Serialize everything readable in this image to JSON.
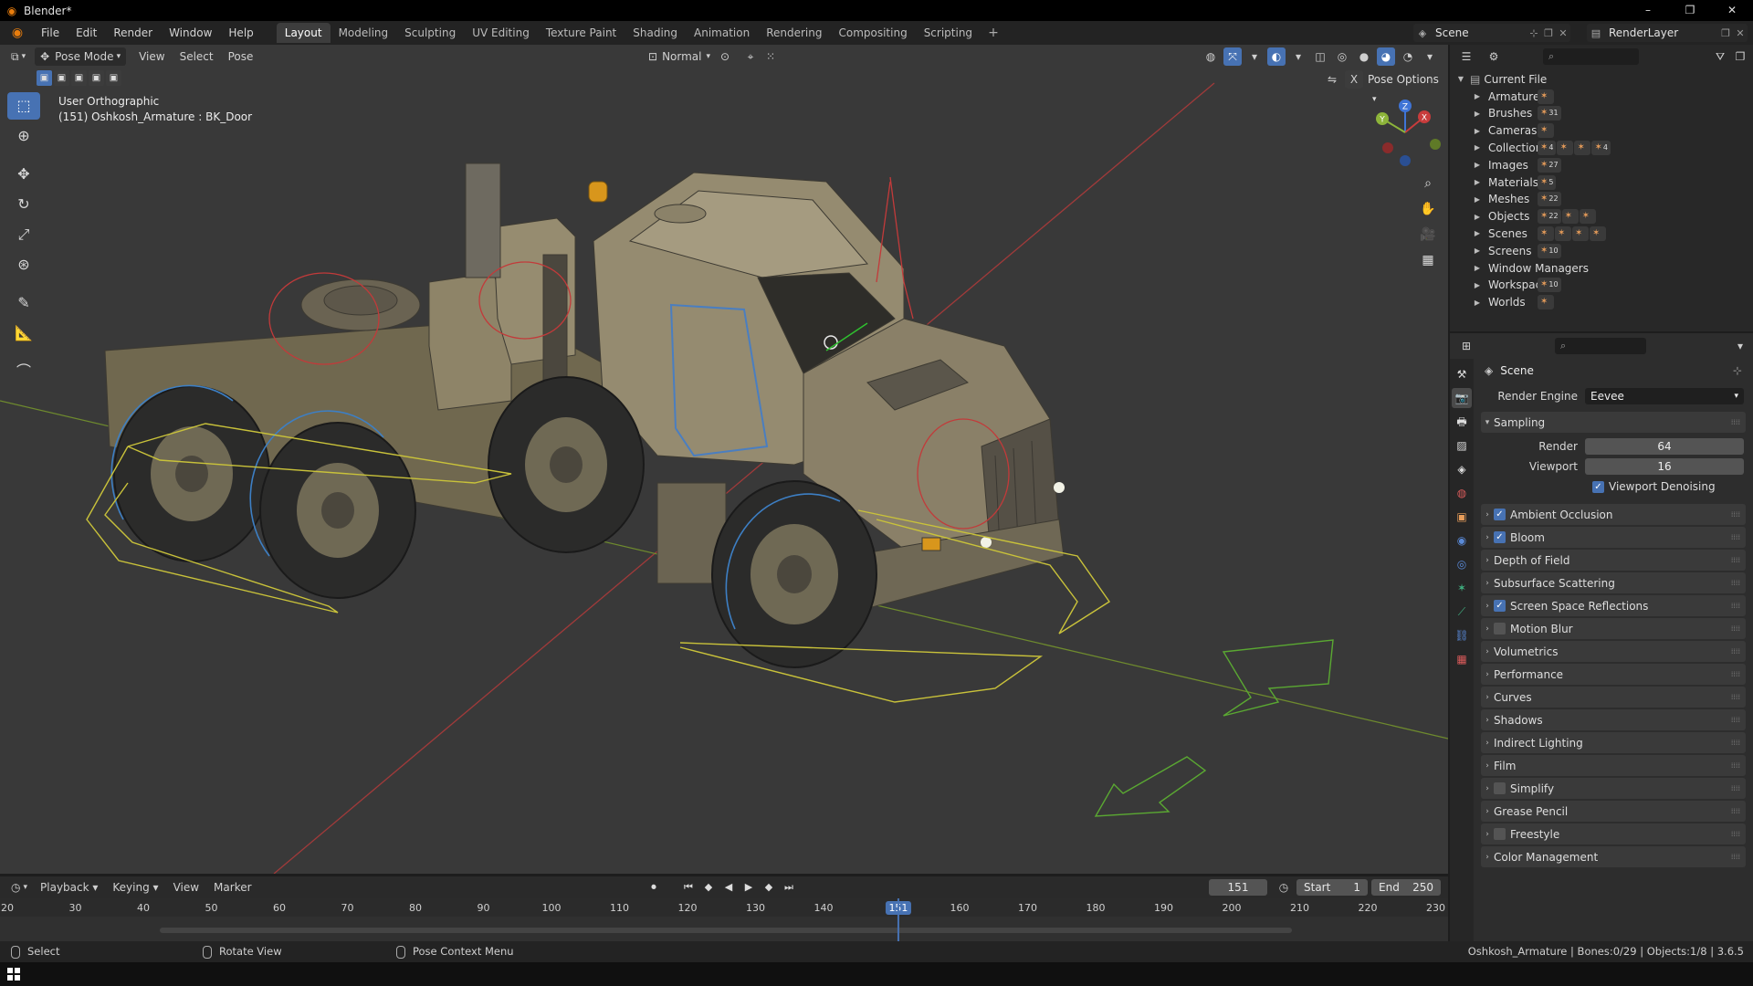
{
  "window": {
    "title": "Blender*",
    "minimize": "–",
    "maximize": "❐",
    "close": "✕"
  },
  "menu": [
    "File",
    "Edit",
    "Render",
    "Window",
    "Help"
  ],
  "workspaces": [
    "Layout",
    "Modeling",
    "Sculpting",
    "UV Editing",
    "Texture Paint",
    "Shading",
    "Animation",
    "Rendering",
    "Compositing",
    "Scripting"
  ],
  "workspace_add": "+",
  "scene_name": "Scene",
  "render_layer": "RenderLayer",
  "viewport": {
    "mode": "Pose Mode",
    "menus": [
      "View",
      "Select",
      "Pose"
    ],
    "orientation": "Normal",
    "pose_options": "Pose Options",
    "view_name": "User Orthographic",
    "object_info": "(151) Oshkosh_Armature : BK_Door",
    "gizmo": {
      "x": "X",
      "y": "Y",
      "z": "Z"
    }
  },
  "timeline": {
    "menus": [
      "Playback",
      "Keying",
      "View",
      "Marker"
    ],
    "current_frame": "151",
    "start_label": "Start",
    "start": "1",
    "end_label": "End",
    "end": "250",
    "ticks": [
      "20",
      "30",
      "40",
      "50",
      "60",
      "70",
      "80",
      "90",
      "100",
      "110",
      "120",
      "130",
      "140",
      "151",
      "160",
      "170",
      "180",
      "190",
      "200",
      "210",
      "220",
      "230"
    ]
  },
  "outliner": {
    "root": "Current File",
    "items": [
      {
        "label": "Armatures",
        "badges": [
          ""
        ]
      },
      {
        "label": "Brushes",
        "badges": [
          "31"
        ]
      },
      {
        "label": "Cameras",
        "badges": [
          ""
        ]
      },
      {
        "label": "Collections",
        "badges": [
          "4",
          "",
          "",
          "4"
        ]
      },
      {
        "label": "Images",
        "badges": [
          "27"
        ]
      },
      {
        "label": "Materials",
        "badges": [
          "5"
        ]
      },
      {
        "label": "Meshes",
        "badges": [
          "22"
        ]
      },
      {
        "label": "Objects",
        "badges": [
          "22",
          "",
          ""
        ]
      },
      {
        "label": "Scenes",
        "badges": [
          "",
          "",
          "",
          ""
        ]
      },
      {
        "label": "Screens",
        "badges": [
          "10"
        ]
      },
      {
        "label": "Window Managers",
        "badges": []
      },
      {
        "label": "Workspaces",
        "badges": [
          "10"
        ]
      },
      {
        "label": "Worlds",
        "badges": [
          ""
        ]
      }
    ]
  },
  "properties": {
    "context": "Scene",
    "render_engine_label": "Render Engine",
    "render_engine": "Eevee",
    "sampling": {
      "title": "Sampling",
      "render_label": "Render",
      "render": "64",
      "viewport_label": "Viewport",
      "viewport": "16",
      "denoise": "Viewport Denoising"
    },
    "panels": [
      {
        "label": "Ambient Occlusion",
        "checkbox": true,
        "checked": true
      },
      {
        "label": "Bloom",
        "checkbox": true,
        "checked": true
      },
      {
        "label": "Depth of Field",
        "checkbox": false,
        "checked": false
      },
      {
        "label": "Subsurface Scattering",
        "checkbox": false,
        "checked": false
      },
      {
        "label": "Screen Space Reflections",
        "checkbox": true,
        "checked": true
      },
      {
        "label": "Motion Blur",
        "checkbox": true,
        "checked": false
      },
      {
        "label": "Volumetrics",
        "checkbox": false,
        "checked": false
      },
      {
        "label": "Performance",
        "checkbox": false,
        "checked": false
      },
      {
        "label": "Curves",
        "checkbox": false,
        "checked": false
      },
      {
        "label": "Shadows",
        "checkbox": false,
        "checked": false
      },
      {
        "label": "Indirect Lighting",
        "checkbox": false,
        "checked": false
      },
      {
        "label": "Film",
        "checkbox": false,
        "checked": false
      },
      {
        "label": "Simplify",
        "checkbox": true,
        "checked": false
      },
      {
        "label": "Grease Pencil",
        "checkbox": false,
        "checked": false
      },
      {
        "label": "Freestyle",
        "checkbox": true,
        "checked": false
      },
      {
        "label": "Color Management",
        "checkbox": false,
        "checked": false
      }
    ]
  },
  "status": {
    "select": "Select",
    "rotate": "Rotate View",
    "context_menu": "Pose Context Menu",
    "info": "Oshkosh_Armature | Bones:0/29 | Objects:1/8 | 3.6.5"
  },
  "colors": {
    "accent": "#4772b3",
    "x_axis": "#c83c3c",
    "y_axis": "#8db43a",
    "z_axis": "#3f74d6",
    "truck": "#8a8068"
  }
}
